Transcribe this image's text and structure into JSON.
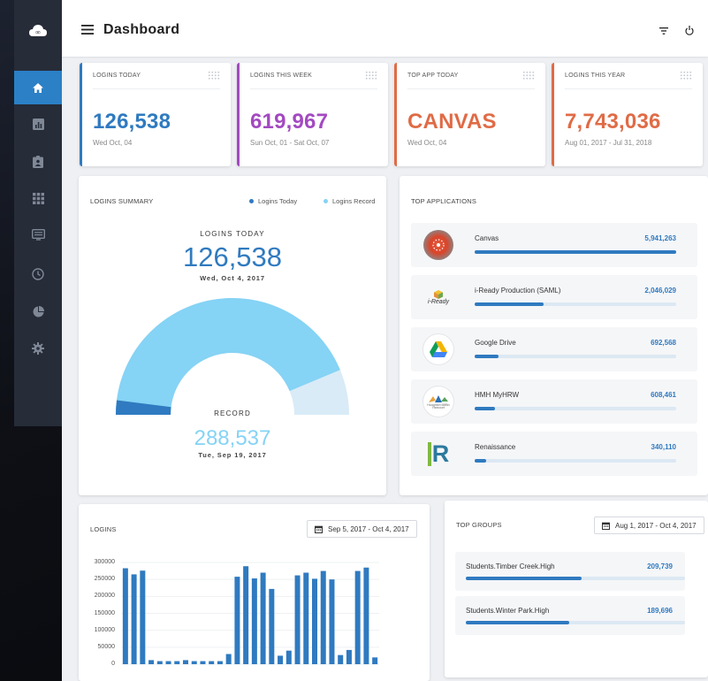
{
  "header": {
    "title": "Dashboard"
  },
  "colors": {
    "accent": "#2b80c6",
    "blue": "#2f7ac0",
    "purple": "#a349c1",
    "orange": "#e06b46",
    "gauge_light": "#85d3f5",
    "gauge_record": "#d9ebf7"
  },
  "sidebar": {
    "items": [
      {
        "icon": "home-icon",
        "active": true
      },
      {
        "icon": "bar-chart-icon"
      },
      {
        "icon": "id-badge-icon"
      },
      {
        "icon": "apps-grid-icon"
      },
      {
        "icon": "monitor-icon"
      },
      {
        "icon": "clock-icon"
      },
      {
        "icon": "pie-chart-icon"
      },
      {
        "icon": "gear-icon"
      }
    ]
  },
  "stats": [
    {
      "label": "LOGINS TODAY",
      "value": "126,538",
      "sub": "Wed Oct, 04"
    },
    {
      "label": "LOGINS THIS WEEK",
      "value": "619,967",
      "sub": "Sun Oct, 01 - Sat Oct, 07"
    },
    {
      "label": "TOP APP TODAY",
      "value": "CANVAS",
      "sub": "Wed Oct, 04"
    },
    {
      "label": "LOGINS THIS YEAR",
      "value": "7,743,036",
      "sub": "Aug 01, 2017 - Jul 31, 2018"
    }
  ],
  "summary": {
    "title": "LOGINS SUMMARY",
    "legend": [
      "Logins Today",
      "Logins Record"
    ],
    "today_label": "LOGINS TODAY",
    "today_value": "126,538",
    "today_date": "Wed, Oct 4, 2017",
    "record_label": "RECORD",
    "record_value": "288,537",
    "record_date": "Tue, Sep 19, 2017",
    "gauge": {
      "today": 126538,
      "record": 288537,
      "max": 330000
    }
  },
  "top_apps": {
    "title": "TOP APPLICATIONS",
    "items": [
      {
        "name": "Canvas",
        "value": "5,941,263",
        "fraction": 1.0
      },
      {
        "name": "i-Ready Production (SAML)",
        "value": "2,046,029",
        "fraction": 0.344
      },
      {
        "name": "Google Drive",
        "value": "692,568",
        "fraction": 0.117
      },
      {
        "name": "HMH MyHRW",
        "value": "608,461",
        "fraction": 0.102
      },
      {
        "name": "Renaissance",
        "value": "340,110",
        "fraction": 0.057
      }
    ],
    "iready_logo_text": "i-Ready",
    "hmh_logo_text": "Houghton Mifflin Harcourt",
    "renaissance_logo_text": "R"
  },
  "logins_chart": {
    "title": "LOGINS",
    "date_range": "Sep 5, 2017 - Oct 4, 2017"
  },
  "chart_data": {
    "type": "bar",
    "values": [
      283000,
      265000,
      276000,
      12000,
      9000,
      9000,
      9000,
      12000,
      9000,
      9000,
      9000,
      9000,
      30000,
      258000,
      289000,
      253000,
      270000,
      222000,
      25000,
      40000,
      262000,
      270000,
      252000,
      275000,
      250000,
      27000,
      42000,
      275000,
      285000,
      20000
    ],
    "ylim": [
      0,
      300000
    ],
    "yticks": [
      "300000",
      "250000",
      "200000",
      "150000",
      "100000",
      "50000",
      "0"
    ],
    "grid": true
  },
  "top_groups": {
    "title": "TOP GROUPS",
    "date_range": "Aug 1, 2017 - Oct 4, 2017",
    "items": [
      {
        "name": "Students.Timber Creek.High",
        "value": "209,739",
        "fraction": 0.53
      },
      {
        "name": "Students.Winter Park.High",
        "value": "189,696",
        "fraction": 0.47
      }
    ]
  }
}
